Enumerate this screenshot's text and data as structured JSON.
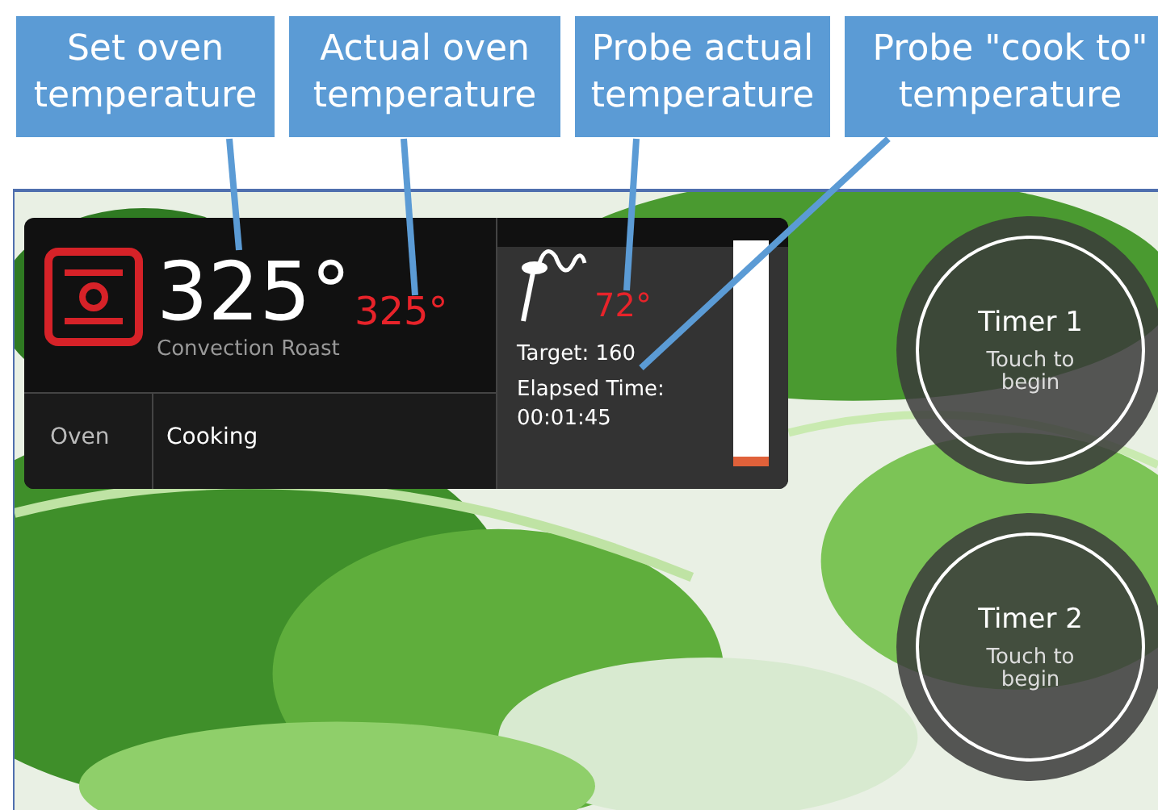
{
  "callouts": [
    {
      "text": "Set oven\ntemperature"
    },
    {
      "text": "Actual oven\ntemperature"
    },
    {
      "text": "Probe actual\ntemperature"
    },
    {
      "text": "Probe \"cook to\"\ntemperature"
    }
  ],
  "oven": {
    "set_temp": "325°",
    "actual_temp": "325°",
    "mode": "Convection Roast",
    "label": "Oven",
    "status": "Cooking"
  },
  "probe": {
    "temp": "72°",
    "target": "Target: 160",
    "elapsed_label": "Elapsed Time:",
    "elapsed": "00:01:45",
    "level": 0.04
  },
  "timers": [
    {
      "title": "Timer 1",
      "hint": "Touch to\nbegin"
    },
    {
      "title": "Timer 2",
      "hint": "Touch to\nbegin"
    }
  ]
}
